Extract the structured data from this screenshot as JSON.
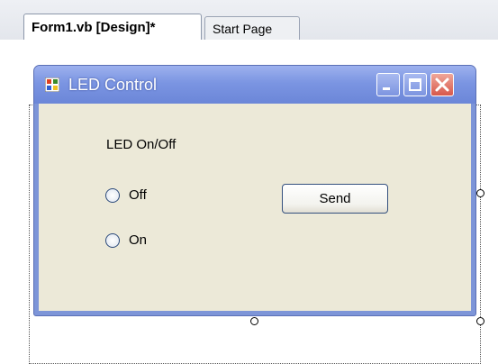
{
  "tabs": [
    {
      "label": "Form1.vb [Design]*",
      "active": true
    },
    {
      "label": "Start Page",
      "active": false
    }
  ],
  "form": {
    "title": "LED Control",
    "icon": "form-app-icon",
    "caption_buttons": [
      "minimize-icon",
      "maximize-icon",
      "close-icon"
    ],
    "group_label": "LED On/Off",
    "radios": [
      {
        "label": "Off",
        "checked": false
      },
      {
        "label": "On",
        "checked": false
      }
    ],
    "send_button": "Send"
  },
  "colors": {
    "titlebar": "#7b95e2",
    "client_bg": "#ece9d8",
    "close_button": "#d7584b"
  }
}
